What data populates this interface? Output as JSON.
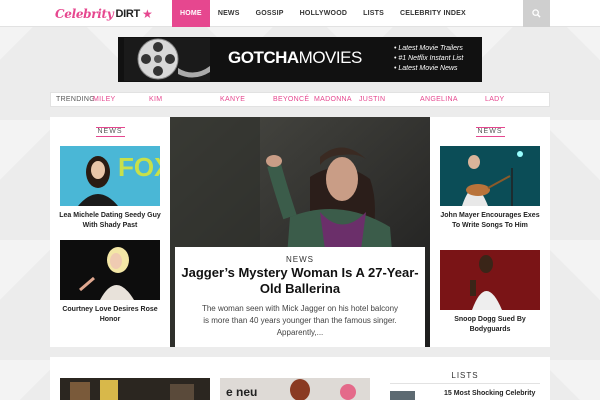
{
  "logo": {
    "text": "Celebrity",
    "dirt": "DIRT",
    "star": "★"
  },
  "nav": [
    "HOME",
    "NEWS",
    "GOSSIP",
    "HOLLYWOOD",
    "LISTS",
    "CELEBRITY INDEX"
  ],
  "search": {
    "icon": "search-icon"
  },
  "banner": {
    "title_bold": "GOTCHA",
    "title_thin": "MOVIES",
    "items": [
      "• Latest Movie Trailers",
      "• #1 Netflix Instant List",
      "• Latest Movie News"
    ]
  },
  "trending": {
    "label": "TRENDING",
    "items": [
      "MILEY",
      "KIM",
      "KANYE",
      "BEYONCÉ",
      "MADONNA",
      "JUSTIN",
      "ANGELINA",
      "LADY"
    ]
  },
  "left_col": {
    "section": "NEWS",
    "stories": [
      {
        "caption": "Lea Michele Dating Seedy Guy With Shady Past"
      },
      {
        "caption": "Courtney Love Desires Rose Honor"
      }
    ]
  },
  "hero": {
    "section": "NEWS",
    "title": "Jagger’s Mystery Woman Is A 27-Year-Old Ballerina",
    "excerpt": "The woman seen with Mick Jagger on his hotel balcony is more than 40 years younger than the famous singer.  Apparently,..."
  },
  "right_col": {
    "section": "NEWS",
    "stories": [
      {
        "caption": "John Mayer Encourages Exes To Write Songs To Him"
      },
      {
        "caption": "Snoop Dogg Sued By Bodyguards"
      }
    ]
  },
  "lists": {
    "label": "LISTS",
    "item": "15 Most Shocking Celebrity"
  },
  "colors": {
    "accent": "#e6478f",
    "background": "#ececec"
  }
}
